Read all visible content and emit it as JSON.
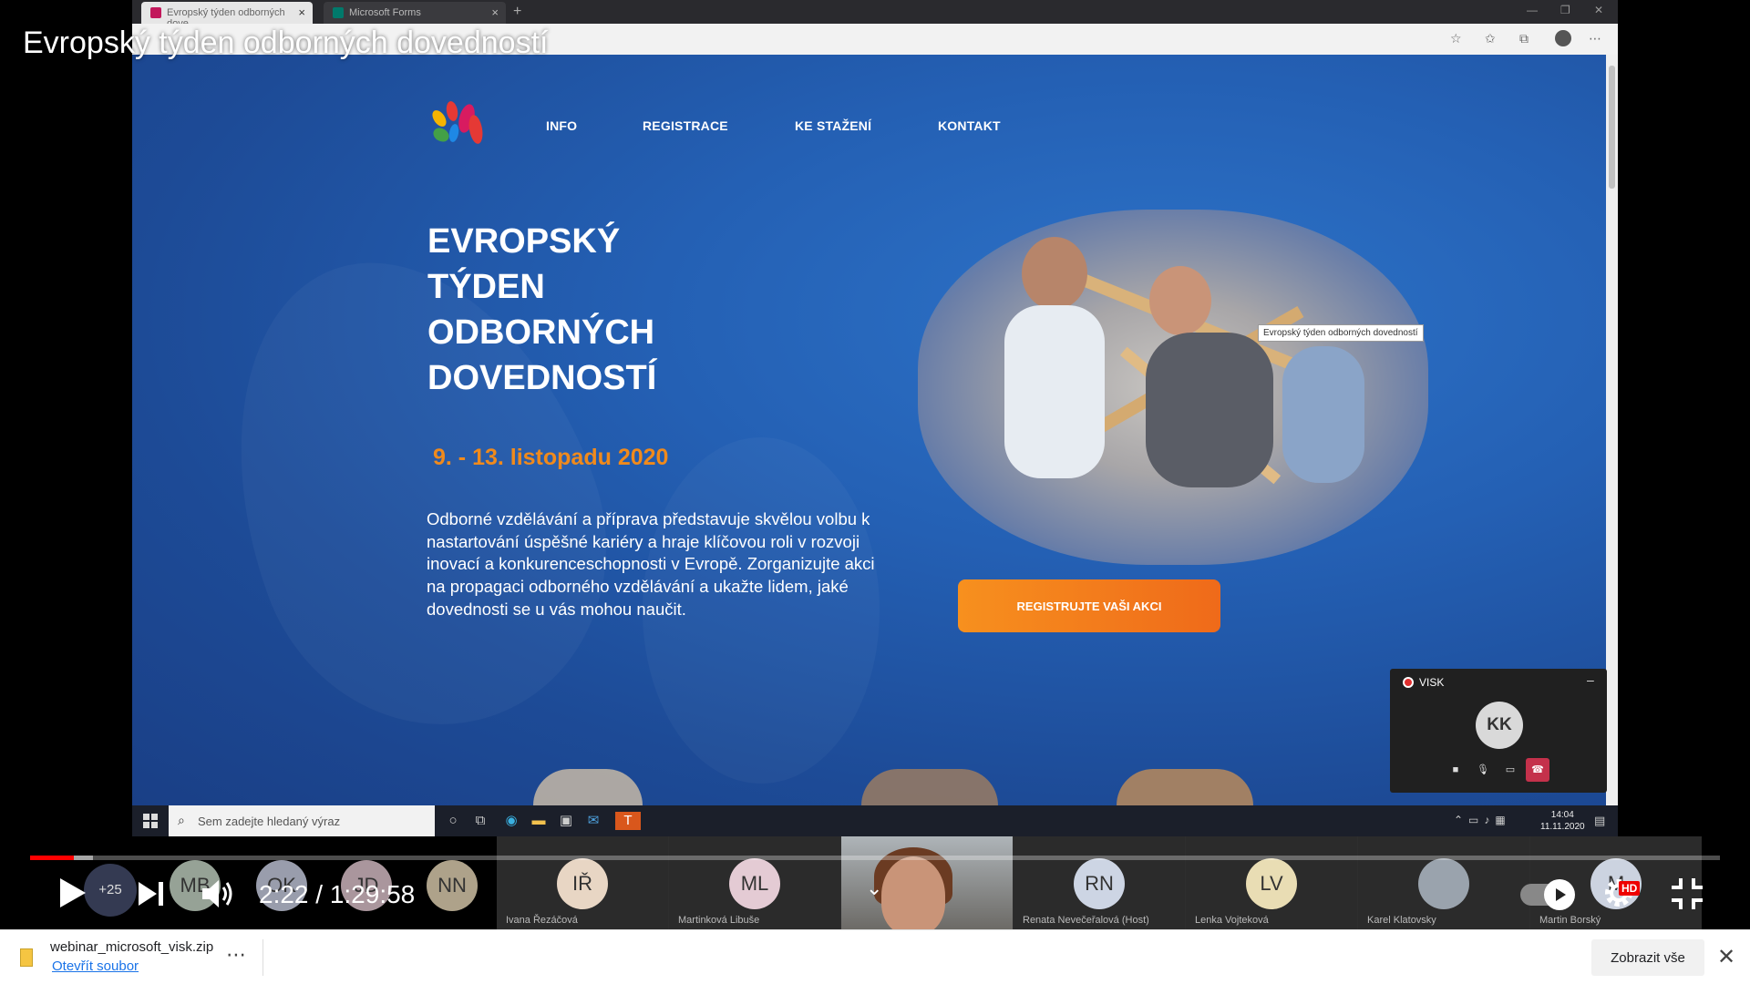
{
  "video": {
    "title": "Evropský týden odborných dovedností",
    "time": "2:22 / 1:29:58",
    "progress_played": 0.026,
    "progress_buffered": 0.037,
    "hd_label": "HD",
    "more_participants": "+25"
  },
  "browser": {
    "tabs": [
      {
        "label": "Evropský týden odborných dove",
        "icon_color": "#c2185b",
        "active": true
      },
      {
        "label": "Microsoft Forms",
        "icon_color": "#00796b",
        "active": false
      }
    ]
  },
  "website": {
    "nav": [
      "INFO",
      "REGISTRACE",
      "KE STAŽENÍ",
      "KONTAKT"
    ],
    "hero_title_lines": [
      "EVROPSKÝ",
      "TÝDEN",
      "ODBORNÝCH",
      "DOVEDNOSTÍ"
    ],
    "date": "9. - 13. listopadu 2020",
    "description": "Odborné vzdělávání a příprava představuje skvělou volbu k nastartování úspěšné kariéry a hraje klíčovou roli v rozvoji inovací a konkurenceschopnosti v Evropě. Zorganizujte akci na propagaci odborného vzdělávání a ukažte lidem, jaké dovednosti se u vás mohou naučit.",
    "tooltip": "Evropský týden odborných dovedností",
    "cta_label": "REGISTRUJTE VAŠI AKCI",
    "colors": {
      "background": "#2460b4",
      "date": "#f08a1c",
      "cta": "#f7901e"
    }
  },
  "call_widget": {
    "title": "VISK",
    "avatar": "KK"
  },
  "taskbar": {
    "search_placeholder": "Sem zadejte hledaný výraz",
    "time": "14:04",
    "date": "11.11.2020"
  },
  "participants": [
    {
      "initials": "IŘ",
      "name": "Ivana Řezáčová",
      "color": "#e8d6c4"
    },
    {
      "initials": "ML",
      "name": "Martinková Libuše",
      "color": "#e4cbd4"
    },
    {
      "initials": "",
      "name": "",
      "color": "#888888"
    },
    {
      "initials": "RN",
      "name": "Renata Nevečeřalová (Host)",
      "color": "#cdd5e4"
    },
    {
      "initials": "LV",
      "name": "Lenka Vojteková",
      "color": "#e9ddb4"
    },
    {
      "initials": "",
      "name": "Karel Klatovsky",
      "color": "#9aa3ad"
    },
    {
      "initials": "M",
      "name": "Martin Borský",
      "color": "#ccd3e0"
    }
  ],
  "ghost_avatars": [
    {
      "initials": "MB",
      "color": "#c8d8c8"
    },
    {
      "initials": "OK",
      "color": "#cdd2e6"
    },
    {
      "initials": "JD",
      "color": "#e3c8d2"
    },
    {
      "initials": "NN",
      "color": "#e8d9b8"
    }
  ],
  "download": {
    "filename": "webinar_microsoft_visk.zip",
    "open_label": "Otevřít soubor",
    "show_all_label": "Zobrazit vše"
  }
}
